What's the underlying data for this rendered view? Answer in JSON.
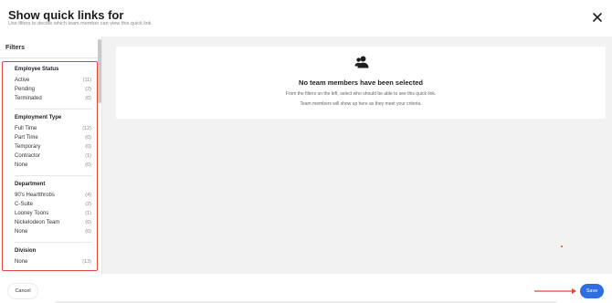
{
  "header": {
    "title": "Show quick links for",
    "subtitle": "Use filters to decide which team member can view this quick link"
  },
  "sidebar": {
    "title": "Filters",
    "groups": [
      {
        "title": "Employee Status",
        "options": [
          {
            "label": "Active",
            "count": "(11)"
          },
          {
            "label": "Pending",
            "count": "(2)"
          },
          {
            "label": "Terminated",
            "count": "(0)"
          }
        ]
      },
      {
        "title": "Employment Type",
        "options": [
          {
            "label": "Full Time",
            "count": "(12)"
          },
          {
            "label": "Part Time",
            "count": "(0)"
          },
          {
            "label": "Temporary",
            "count": "(0)"
          },
          {
            "label": "Contractor",
            "count": "(1)"
          },
          {
            "label": "None",
            "count": "(0)"
          }
        ]
      },
      {
        "title": "Department",
        "options": [
          {
            "label": "90's Heartthrobs",
            "count": "(4)"
          },
          {
            "label": "C-Suite",
            "count": "(2)"
          },
          {
            "label": "Looney Toons",
            "count": "(1)"
          },
          {
            "label": "Nickelodeon Team",
            "count": "(6)"
          },
          {
            "label": "None",
            "count": "(0)"
          }
        ]
      },
      {
        "title": "Division",
        "options": [
          {
            "label": "None",
            "count": "(13)"
          }
        ]
      }
    ]
  },
  "main": {
    "empty_icon": "team-members-icon",
    "empty_title": "No team members have been selected",
    "empty_line1": "From the filters on the left, select who should be able to see this quick link.",
    "empty_line2": "Team members will show up here as they meet your criteria."
  },
  "footer": {
    "cancel_label": "Cancel",
    "save_label": "Save"
  },
  "colors": {
    "accent": "#2f6de1",
    "highlight": "#e0483a",
    "panel_bg": "#f2f2f2"
  }
}
